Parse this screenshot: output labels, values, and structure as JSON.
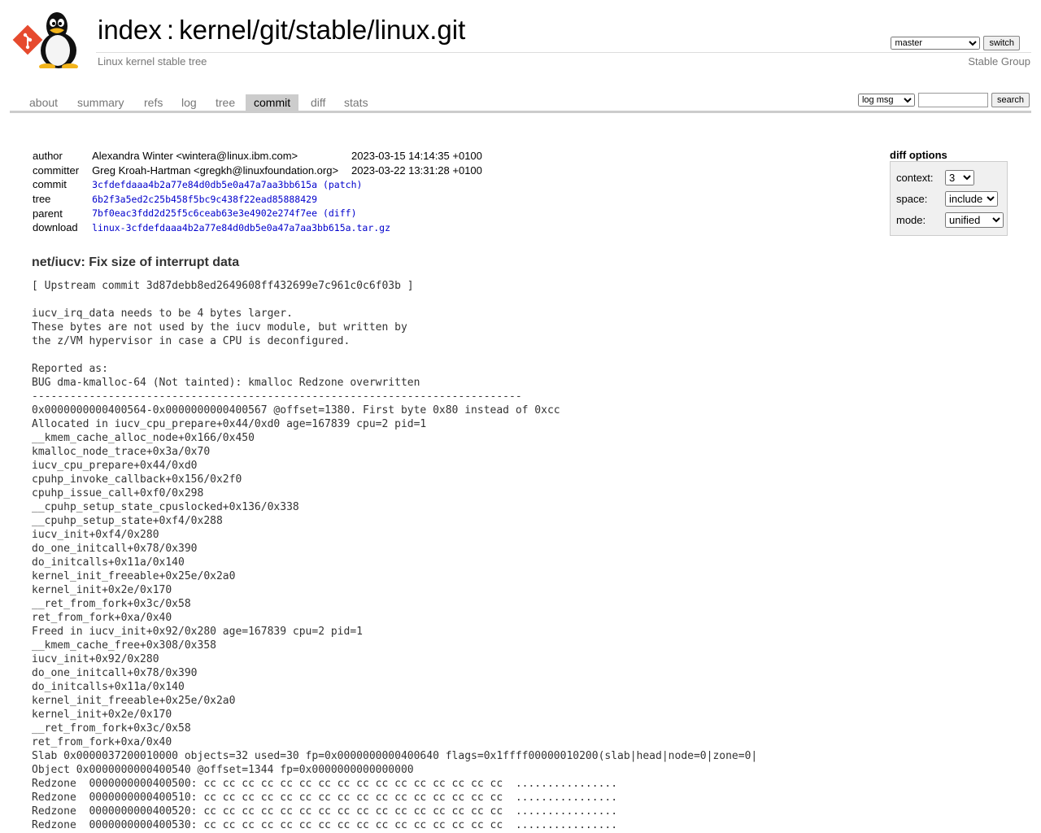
{
  "header": {
    "index_label": "index",
    "separator": ":",
    "repo_path": "kernel/git/stable/linux.git",
    "description": "Linux kernel stable tree",
    "owner": "Stable Group",
    "branch_selected": "master",
    "switch_label": "switch"
  },
  "tabs": [
    {
      "label": "about",
      "active": false
    },
    {
      "label": "summary",
      "active": false
    },
    {
      "label": "refs",
      "active": false
    },
    {
      "label": "log",
      "active": false
    },
    {
      "label": "tree",
      "active": false
    },
    {
      "label": "commit",
      "active": true
    },
    {
      "label": "diff",
      "active": false
    },
    {
      "label": "stats",
      "active": false
    }
  ],
  "search": {
    "mode_selected": "log msg",
    "query": "",
    "button_label": "search"
  },
  "commit_info": {
    "author_key": "author",
    "author": "Alexandra Winter <wintera@linux.ibm.com>",
    "author_date": "2023-03-15 14:14:35 +0100",
    "committer_key": "committer",
    "committer": "Greg Kroah-Hartman <gregkh@linuxfoundation.org>",
    "committer_date": "2023-03-22 13:31:28 +0100",
    "commit_key": "commit",
    "commit_sha": "3cfdefdaaa4b2a77e84d0db5e0a47a7aa3bb615a",
    "patch_link": "(patch)",
    "tree_key": "tree",
    "tree_sha": "6b2f3a5ed2c25b458f5bc9c438f22ead85888429",
    "parent_key": "parent",
    "parent_sha": "7bf0eac3fdd2d25f5c6ceab63e3e4902e274f7ee",
    "diff_link": "(diff)",
    "download_key": "download",
    "download_file": "linux-3cfdefdaaa4b2a77e84d0db5e0a47a7aa3bb615a.tar.gz"
  },
  "diff_options": {
    "title": "diff options",
    "context_label": "context:",
    "context_value": "3",
    "space_label": "space:",
    "space_value": "include",
    "mode_label": "mode:",
    "mode_value": "unified"
  },
  "commit_subject": "net/iucv: Fix size of interrupt data",
  "commit_message": "[ Upstream commit 3d87debb8ed2649608ff432699e7c961c0c6f03b ]\n\niucv_irq_data needs to be 4 bytes larger.\nThese bytes are not used by the iucv module, but written by\nthe z/VM hypervisor in case a CPU is deconfigured.\n\nReported as:\nBUG dma-kmalloc-64 (Not tainted): kmalloc Redzone overwritten\n-----------------------------------------------------------------------------\n0x0000000000400564-0x0000000000400567 @offset=1380. First byte 0x80 instead of 0xcc\nAllocated in iucv_cpu_prepare+0x44/0xd0 age=167839 cpu=2 pid=1\n__kmem_cache_alloc_node+0x166/0x450\nkmalloc_node_trace+0x3a/0x70\niucv_cpu_prepare+0x44/0xd0\ncpuhp_invoke_callback+0x156/0x2f0\ncpuhp_issue_call+0xf0/0x298\n__cpuhp_setup_state_cpuslocked+0x136/0x338\n__cpuhp_setup_state+0xf4/0x288\niucv_init+0xf4/0x280\ndo_one_initcall+0x78/0x390\ndo_initcalls+0x11a/0x140\nkernel_init_freeable+0x25e/0x2a0\nkernel_init+0x2e/0x170\n__ret_from_fork+0x3c/0x58\nret_from_fork+0xa/0x40\nFreed in iucv_init+0x92/0x280 age=167839 cpu=2 pid=1\n__kmem_cache_free+0x308/0x358\niucv_init+0x92/0x280\ndo_one_initcall+0x78/0x390\ndo_initcalls+0x11a/0x140\nkernel_init_freeable+0x25e/0x2a0\nkernel_init+0x2e/0x170\n__ret_from_fork+0x3c/0x58\nret_from_fork+0xa/0x40\nSlab 0x0000037200010000 objects=32 used=30 fp=0x0000000000400640 flags=0x1ffff00000010200(slab|head|node=0|zone=0|\nObject 0x0000000000400540 @offset=1344 fp=0x0000000000000000\nRedzone  0000000000400500: cc cc cc cc cc cc cc cc cc cc cc cc cc cc cc cc  ................\nRedzone  0000000000400510: cc cc cc cc cc cc cc cc cc cc cc cc cc cc cc cc  ................\nRedzone  0000000000400520: cc cc cc cc cc cc cc cc cc cc cc cc cc cc cc cc  ................\nRedzone  0000000000400530: cc cc cc cc cc cc cc cc cc cc cc cc cc cc cc cc  ................",
  "colors": {
    "link": "#0000cc",
    "tab_active_bg": "#cccccc",
    "muted_text": "#777777",
    "git_logo": "#e64a2e"
  }
}
